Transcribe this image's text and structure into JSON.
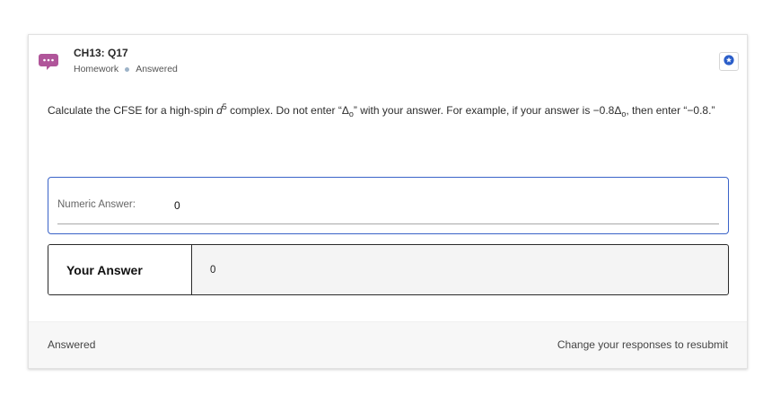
{
  "header": {
    "title": "CH13: Q17",
    "type": "Homework",
    "status": "Answered",
    "chat_icon": "chat-bubble-icon",
    "star_icon": "star-icon"
  },
  "question": {
    "part1": "Calculate the CFSE for a high-spin ",
    "d_symbol": "d",
    "d_exponent": "5",
    "part2": " complex. Do not enter “Δ",
    "sub1": "o",
    "part3": "” with your answer. For example, if your answer is −0.8Δ",
    "sub2": "o",
    "part4": ", then enter “−0.8.”"
  },
  "answer_input": {
    "label": "Numeric Answer:",
    "value": "0"
  },
  "your_answer": {
    "label": "Your Answer",
    "value": "0"
  },
  "footer": {
    "status": "Answered",
    "note": "Change your responses to resubmit"
  },
  "colors": {
    "chat_icon": "#b0559a",
    "star_icon": "#2b5ec9",
    "input_border": "#3a63c8"
  }
}
